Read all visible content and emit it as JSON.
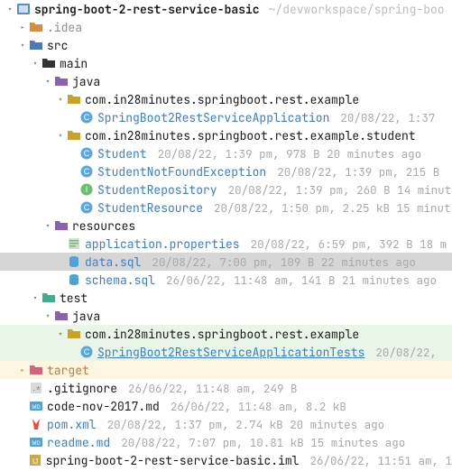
{
  "root": {
    "name": "spring-boot-2-rest-service-basic",
    "hint": "~/devworkspace/spring-boo"
  },
  "idea": {
    "name": ".idea"
  },
  "src": {
    "name": "src"
  },
  "main": {
    "name": "main"
  },
  "java_main": {
    "name": "java"
  },
  "pkg_example": {
    "name": "com.in28minutes.springboot.rest.example"
  },
  "app_class": {
    "name": "SpringBoot2RestServiceApplication",
    "meta": "20/08/22, 1:37"
  },
  "pkg_student": {
    "name": "com.in28minutes.springboot.rest.example.student"
  },
  "student": {
    "name": "Student",
    "meta": "20/08/22, 1:39 pm, 978 B 20 minutes ago"
  },
  "student_nfe": {
    "name": "StudentNotFoundException",
    "meta": "20/08/22, 1:39 pm, 215 B"
  },
  "student_repo": {
    "name": "StudentRepository",
    "meta": "20/08/22, 1:39 pm, 260 B 14 minut"
  },
  "student_res": {
    "name": "StudentResource",
    "meta": "20/08/22, 1:50 pm, 2.25 kB 15 minut"
  },
  "resources": {
    "name": "resources"
  },
  "app_props": {
    "name": "application.properties",
    "meta": "20/08/22, 6:59 pm, 392 B 18 m"
  },
  "data_sql": {
    "name": "data.sql",
    "meta": "20/08/22, 7:00 pm, 109 B 22 minutes ago"
  },
  "schema_sql": {
    "name": "schema.sql",
    "meta": "26/06/22, 11:48 am, 141 B 21 minutes ago"
  },
  "test": {
    "name": "test"
  },
  "java_test": {
    "name": "java"
  },
  "pkg_example_test": {
    "name": "com.in28minutes.springboot.rest.example"
  },
  "app_tests": {
    "name": "SpringBoot2RestServiceApplicationTests",
    "meta": "20/08/22,"
  },
  "target": {
    "name": "target"
  },
  "gitignore": {
    "name": ".gitignore",
    "meta": "26/06/22, 11:48 am, 249 B"
  },
  "code_nov": {
    "name": "code-nov-2017.md",
    "meta": "26/06/22, 11:48 am, 8.2 kB"
  },
  "pom": {
    "name": "pom.xml",
    "meta": "20/08/22, 1:37 pm, 2.74 kB 20 minutes ago"
  },
  "readme": {
    "name": "readme.md",
    "meta": "20/08/22, 7:07 pm, 10.81 kB 15 minutes ago"
  },
  "iml": {
    "name": "spring-boot-2-rest-service-basic.iml",
    "meta": "26/06/22, 11:51 am, 1"
  }
}
